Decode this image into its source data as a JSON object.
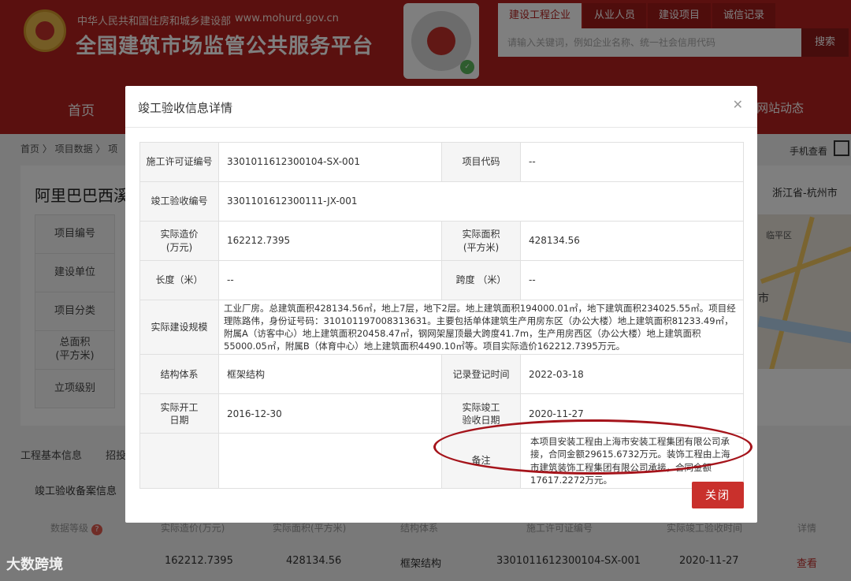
{
  "header": {
    "ministry": "中华人民共和国住房和城乡建设部",
    "url": "www.mohurd.gov.cn",
    "title": "全国建筑市场监管公共服务平台",
    "search_tabs": [
      "建设工程企业",
      "从业人员",
      "建设项目",
      "诚信记录"
    ],
    "search_placeholder": "请输入关键词，例如企业名称、统一社会信用代码",
    "search_button": "搜索",
    "nav_home": "首页",
    "nav_right": "网站动态"
  },
  "breadcrumb": "首页  〉 项目数据  〉 项",
  "mobile_view": "手机查看",
  "project": {
    "name": "阿里巴巴西溪",
    "region": "浙江省-杭州市",
    "left_labels": [
      "项目编号",
      "建设单位",
      "项目分类",
      "总面积\n(平方米)",
      "立项级别"
    ],
    "map_labels": [
      "临平区",
      "市"
    ]
  },
  "tabs_row": [
    "工程基本信息",
    "招投"
  ],
  "sub_tab": "竣工验收备案信息",
  "list": {
    "headers": [
      "数据等级",
      "实际造价(万元)",
      "实际面积(平方米)",
      "结构体系",
      "施工许可证编号",
      "实际竣工验收时间",
      "详情"
    ],
    "row": [
      "162212.7395",
      "428134.56",
      "框架结构",
      "3301011612300104-SX-001",
      "2020-11-27",
      "查看"
    ]
  },
  "modal": {
    "title": "竣工验收信息详情",
    "close_button": "关闭",
    "fields": {
      "permit_no_label": "施工许可证编号",
      "permit_no": "3301011612300104-SX-001",
      "project_code_label": "项目代码",
      "project_code": "--",
      "acceptance_no_label": "竣工验收编号",
      "acceptance_no": "3301101612300111-JX-001",
      "actual_cost_label": "实际造价\n(万元)",
      "actual_cost": "162212.7395",
      "actual_area_label": "实际面积\n(平方米)",
      "actual_area": "428134.56",
      "length_label": "长度（米）",
      "length": "--",
      "span_label": "跨度 （米）",
      "span": "--",
      "scale_label": "实际建设规模",
      "scale": "工业厂房。总建筑面积428134.56㎡，地上7层，地下2层。地上建筑面积194000.01㎡，地下建筑面积234025.55㎡。项目经理陈路伟，身份证号码：310101197008313631。主要包括单体建筑生产用房东区（办公大楼）地上建筑面积81233.49㎡，附属A（访客中心）地上建筑面积20458.47㎡，钢网架屋顶最大跨度41.7m，生产用房西区（办公大楼）地上建筑面积55000.05㎡，附属B（体育中心）地上建筑面积4490.10㎡等。项目实际造价162212.7395万元。",
      "structure_label": "结构体系",
      "structure": "框架结构",
      "record_time_label": "记录登记时间",
      "record_time": "2022-03-18",
      "start_date_label": "实际开工\n日期",
      "start_date": "2016-12-30",
      "completion_date_label": "实际竣工\n验收日期",
      "completion_date": "2020-11-27",
      "remark_label": "备注",
      "remark": "本项目安装工程由上海市安装工程集团有限公司承接，合同金额29615.6732万元。装饰工程由上海市建筑装饰工程集团有限公司承接，合同金额17617.2272万元。"
    }
  },
  "watermark": "大数跨境",
  "colors": {
    "brand_red": "#b4211f",
    "button_red": "#c9302c",
    "annotation_red": "#a5141b"
  }
}
